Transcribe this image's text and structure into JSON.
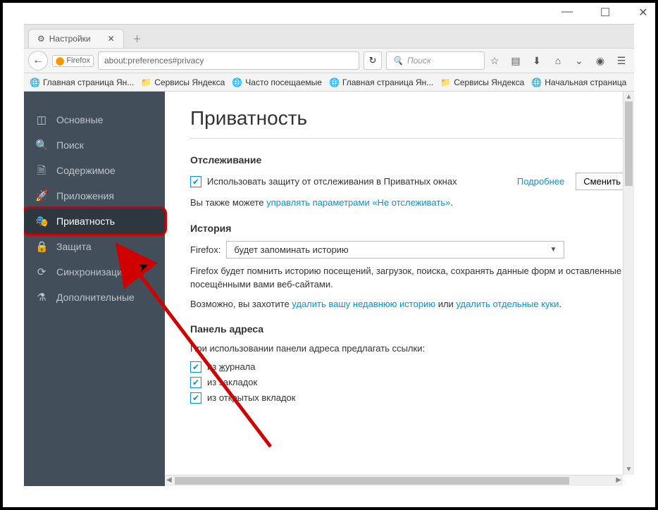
{
  "tab": {
    "title": "Настройки"
  },
  "addressbar": {
    "identity_label": "Firefox",
    "url": "about:preferences#privacy",
    "search_placeholder": "Поиск"
  },
  "bookmarks": [
    {
      "label": "Главная страница Ян...",
      "icon": "globe"
    },
    {
      "label": "Сервисы Яндекса",
      "icon": "folder"
    },
    {
      "label": "Часто посещаемые",
      "icon": "globe-blue"
    },
    {
      "label": "Главная страница Ян...",
      "icon": "globe"
    },
    {
      "label": "Сервисы Яндекса",
      "icon": "folder"
    },
    {
      "label": "Начальная страница",
      "icon": "globe"
    }
  ],
  "sidebar": {
    "items": [
      {
        "label": "Основные"
      },
      {
        "label": "Поиск"
      },
      {
        "label": "Содержимое"
      },
      {
        "label": "Приложения"
      },
      {
        "label": "Приватность",
        "active": true
      },
      {
        "label": "Защита"
      },
      {
        "label": "Синхронизация"
      },
      {
        "label": "Дополнительные"
      }
    ]
  },
  "page": {
    "title": "Приватность",
    "tracking": {
      "header": "Отслеживание",
      "cb_label": "Использовать защиту от отслеживания в Приватных окнах",
      "more_link": "Подробнее",
      "change_btn": "Сменить",
      "subtext_prefix": "Вы также можете ",
      "subtext_link": "управлять параметрами «Не отслеживать»",
      "subtext_suffix": "."
    },
    "history": {
      "header": "История",
      "label": "Firefox:",
      "select": "будет запоминать историю",
      "desc": "Firefox будет помнить историю посещений, загрузок, поиска, сохранять данные форм и оставленные посещёнными вами веб-сайтами.",
      "maybe_prefix": "Возможно, вы захотите ",
      "link1": "удалить вашу недавнюю историю",
      "or": " или ",
      "link2": "удалить отдельные куки",
      "suffix": "."
    },
    "addressbar_panel": {
      "header": "Панель адреса",
      "intro": "При использовании панели адреса предлагать ссылки:",
      "opt1_pre": "из ",
      "opt1_u": "ж",
      "opt1_post": "урнала",
      "opt2": "из закладок",
      "opt3": "из открытых вкладок"
    }
  }
}
